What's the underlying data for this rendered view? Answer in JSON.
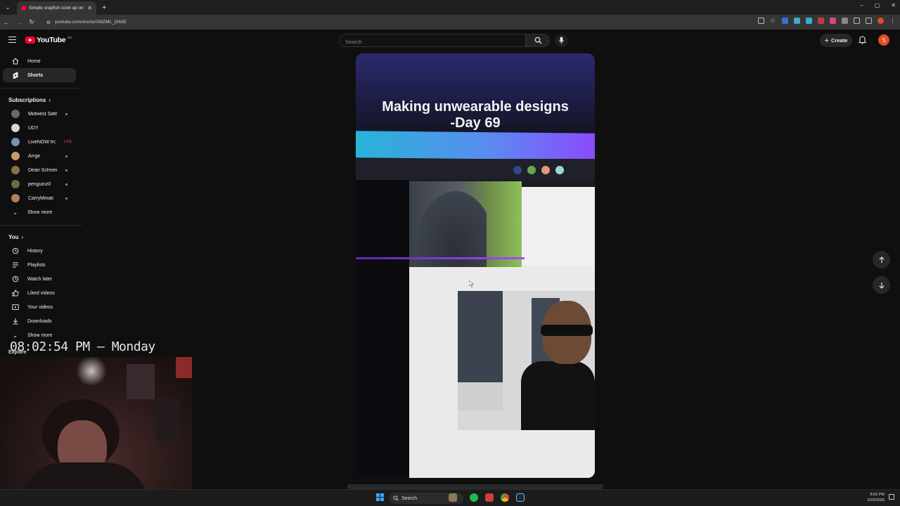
{
  "browser": {
    "tab_title": "Simple crayfish cook up on",
    "url": "youtube.com/shorts/XMZML_jS63E",
    "window_controls": [
      "–",
      "▢",
      "✕"
    ]
  },
  "header": {
    "logo_text": "YouTube",
    "logo_country": "BD",
    "search_placeholder": "Search",
    "create_label": "Create",
    "avatar_letter": "S"
  },
  "sidebar": {
    "main": [
      {
        "label": "Home",
        "icon": "home-icon"
      },
      {
        "label": "Shorts",
        "icon": "shorts-icon",
        "active": true
      }
    ],
    "subscriptions_heading": "Subscriptions",
    "subscriptions": [
      {
        "label": "Midwest Safety",
        "color": "#6a6a6a",
        "dot": true
      },
      {
        "label": "UDY",
        "color": "#d6d6d6",
        "dot": false
      },
      {
        "label": "LiveNOW from F...",
        "color": "#7b8fb0",
        "live": "LIVE"
      },
      {
        "label": "Arrge",
        "color": "#c79b6a",
        "dot": true
      },
      {
        "label": "Dean Schneider",
        "color": "#8c6e4a",
        "dot": true
      },
      {
        "label": "penguinz0",
        "color": "#6b6b4a",
        "dot": true
      },
      {
        "label": "CarryMinati",
        "color": "#b08060",
        "dot": true
      }
    ],
    "show_more": "Show more",
    "you_heading": "You",
    "you_items": [
      {
        "label": "History",
        "icon": "history-icon"
      },
      {
        "label": "Playlists",
        "icon": "playlists-icon"
      },
      {
        "label": "Watch later",
        "icon": "watch-later-icon"
      },
      {
        "label": "Liked videos",
        "icon": "liked-icon"
      },
      {
        "label": "Your videos",
        "icon": "your-videos-icon"
      },
      {
        "label": "Downloads",
        "icon": "downloads-icon"
      }
    ],
    "show_more_2": "Show more",
    "explore_heading": "Explore"
  },
  "short": {
    "title_line1": "Making unwearable designs",
    "title_line2": "-Day 69"
  },
  "overlay": {
    "clock": "08:02:54 PM — Monday"
  },
  "taskbar": {
    "search_label": "Search",
    "time": "8:02 PM",
    "date": "3/23/2026"
  }
}
